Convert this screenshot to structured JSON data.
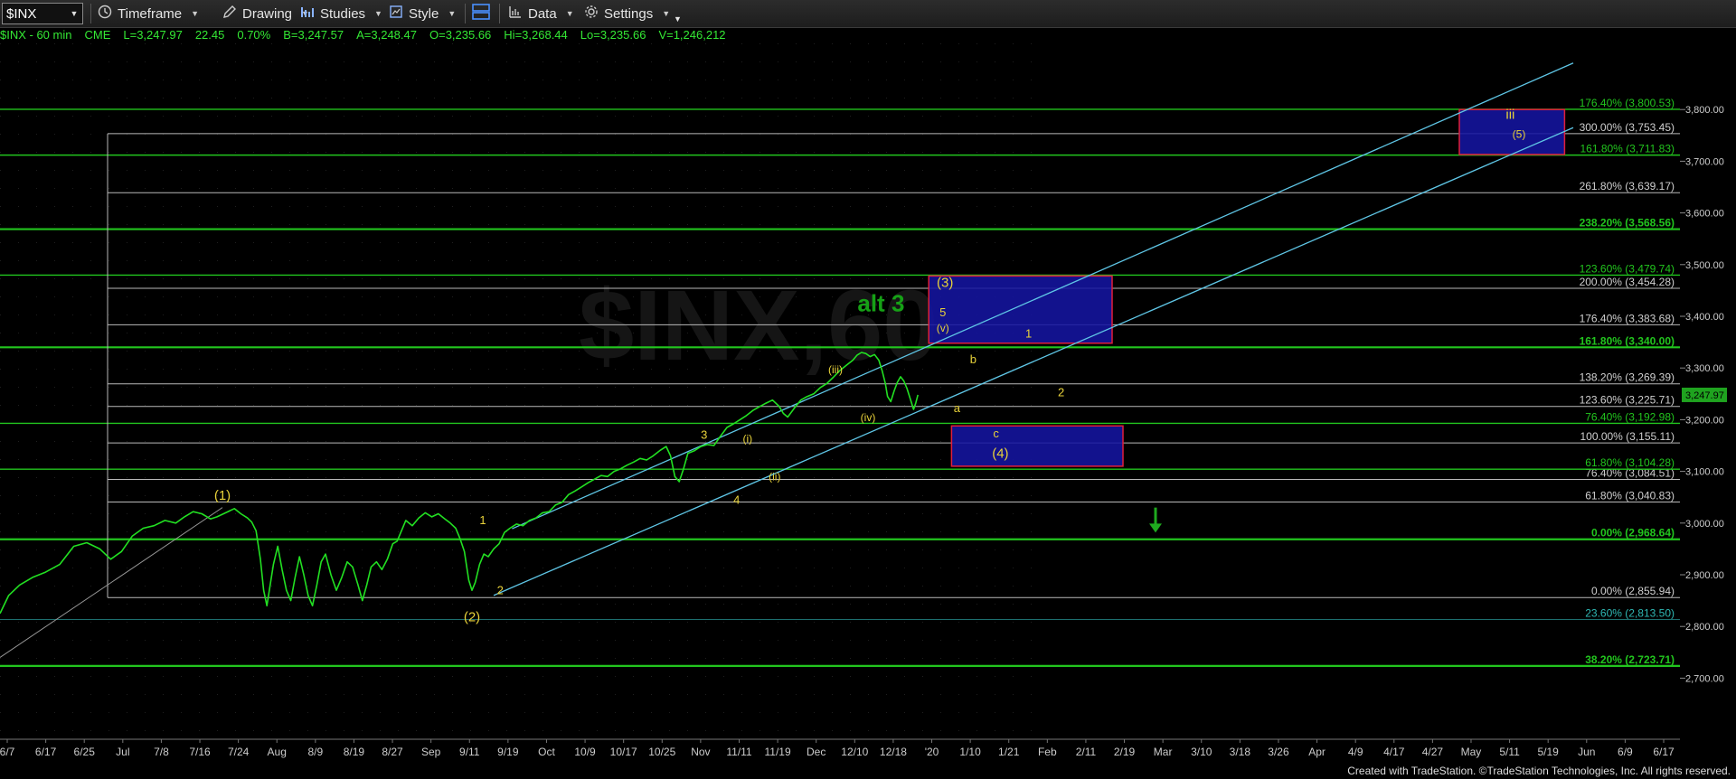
{
  "toolbar": {
    "symbol": "$INX",
    "menus": [
      {
        "label": "Timeframe",
        "icon": "clock-icon"
      },
      {
        "label": "Drawing",
        "icon": "pencil-icon"
      },
      {
        "label": "Studies",
        "icon": "studies-icon"
      },
      {
        "label": "Style",
        "icon": "style-icon"
      },
      {
        "label": "",
        "icon": "layout-icon"
      },
      {
        "label": "Data",
        "icon": "data-icon"
      },
      {
        "label": "Settings",
        "icon": "gear-icon"
      }
    ]
  },
  "infobar": {
    "symbol": "$INX - 60 min",
    "exchange": "CME",
    "last": "L=3,247.97",
    "change": "22.45",
    "pct": "0.70%",
    "bid": "B=3,247.57",
    "ask": "A=3,248.47",
    "open": "O=3,235.66",
    "high": "Hi=3,268.44",
    "low": "Lo=3,235.66",
    "volume": "V=1,246,212"
  },
  "footer": "Created with TradeStation. ©TradeStation Technologies, Inc. All rights reserved.",
  "colors": {
    "price": "#22e022",
    "green_line": "#22c51e",
    "gray_line": "#b9b9b9",
    "channel": "#5fc6e6",
    "box_fill": "#1515a0",
    "box_border": "#e01e3c",
    "wave_label": "#e8d23a",
    "alt_label": "#16a116",
    "teal_text": "#2fb8b4"
  },
  "chart_data": {
    "type": "line",
    "title": "$INX - 60 min",
    "ylim": [
      2640,
      3910
    ],
    "y_ticks": [
      "3,800.00",
      "3,700.00",
      "3,600.00",
      "3,500.00",
      "3,400.00",
      "3,300.00",
      "3,200.00",
      "3,100.00",
      "3,000.00",
      "2,900.00",
      "2,800.00",
      "2,700.00"
    ],
    "last_price_tag": "3,247.97",
    "x_tick_labels": [
      "6/7",
      "6/17",
      "6/25",
      "Jul",
      "7/8",
      "7/16",
      "7/24",
      "Aug",
      "8/9",
      "8/19",
      "8/27",
      "Sep",
      "9/11",
      "9/19",
      "Oct",
      "10/9",
      "10/17",
      "10/25",
      "Nov",
      "11/11",
      "11/19",
      "Dec",
      "12/10",
      "12/18",
      "'20",
      "1/10",
      "1/21",
      "Feb",
      "2/11",
      "2/19",
      "Mar",
      "3/10",
      "3/18",
      "3/26",
      "Apr",
      "4/9",
      "4/17",
      "4/27",
      "May",
      "5/11",
      "5/19",
      "Jun",
      "6/9",
      "6/17"
    ],
    "series": [
      {
        "values": [
          {
            "x": 0,
            "y": 2825
          },
          {
            "x": 8,
            "y": 2860
          },
          {
            "x": 18,
            "y": 2880
          },
          {
            "x": 30,
            "y": 2895
          },
          {
            "x": 42,
            "y": 2905
          },
          {
            "x": 55,
            "y": 2920
          },
          {
            "x": 68,
            "y": 2955
          },
          {
            "x": 80,
            "y": 2962
          },
          {
            "x": 92,
            "y": 2950
          },
          {
            "x": 102,
            "y": 2930
          },
          {
            "x": 112,
            "y": 2945
          },
          {
            "x": 122,
            "y": 2975
          },
          {
            "x": 132,
            "y": 2990
          },
          {
            "x": 142,
            "y": 2995
          },
          {
            "x": 152,
            "y": 3005
          },
          {
            "x": 162,
            "y": 3000
          },
          {
            "x": 170,
            "y": 3012
          },
          {
            "x": 178,
            "y": 3022
          },
          {
            "x": 186,
            "y": 3018
          },
          {
            "x": 194,
            "y": 3008
          },
          {
            "x": 200,
            "y": 3012
          },
          {
            "x": 208,
            "y": 3020
          },
          {
            "x": 216,
            "y": 3028
          },
          {
            "x": 222,
            "y": 3018
          },
          {
            "x": 228,
            "y": 3010
          },
          {
            "x": 232,
            "y": 3002
          },
          {
            "x": 236,
            "y": 2985
          },
          {
            "x": 240,
            "y": 2930
          },
          {
            "x": 243,
            "y": 2870
          },
          {
            "x": 246,
            "y": 2840
          },
          {
            "x": 249,
            "y": 2880
          },
          {
            "x": 252,
            "y": 2920
          },
          {
            "x": 256,
            "y": 2955
          },
          {
            "x": 260,
            "y": 2910
          },
          {
            "x": 264,
            "y": 2870
          },
          {
            "x": 268,
            "y": 2850
          },
          {
            "x": 272,
            "y": 2895
          },
          {
            "x": 276,
            "y": 2935
          },
          {
            "x": 280,
            "y": 2900
          },
          {
            "x": 284,
            "y": 2860
          },
          {
            "x": 288,
            "y": 2840
          },
          {
            "x": 292,
            "y": 2880
          },
          {
            "x": 296,
            "y": 2925
          },
          {
            "x": 300,
            "y": 2940
          },
          {
            "x": 305,
            "y": 2900
          },
          {
            "x": 310,
            "y": 2870
          },
          {
            "x": 315,
            "y": 2895
          },
          {
            "x": 320,
            "y": 2925
          },
          {
            "x": 325,
            "y": 2915
          },
          {
            "x": 330,
            "y": 2880
          },
          {
            "x": 334,
            "y": 2850
          },
          {
            "x": 338,
            "y": 2880
          },
          {
            "x": 342,
            "y": 2915
          },
          {
            "x": 347,
            "y": 2925
          },
          {
            "x": 352,
            "y": 2910
          },
          {
            "x": 357,
            "y": 2930
          },
          {
            "x": 362,
            "y": 2960
          },
          {
            "x": 366,
            "y": 2965
          },
          {
            "x": 370,
            "y": 2985
          },
          {
            "x": 374,
            "y": 3005
          },
          {
            "x": 380,
            "y": 2995
          },
          {
            "x": 386,
            "y": 3010
          },
          {
            "x": 392,
            "y": 3020
          },
          {
            "x": 398,
            "y": 3012
          },
          {
            "x": 404,
            "y": 3018
          },
          {
            "x": 410,
            "y": 3008
          },
          {
            "x": 415,
            "y": 3000
          },
          {
            "x": 420,
            "y": 2990
          },
          {
            "x": 424,
            "y": 2970
          },
          {
            "x": 428,
            "y": 2945
          },
          {
            "x": 432,
            "y": 2890
          },
          {
            "x": 435,
            "y": 2870
          },
          {
            "x": 438,
            "y": 2885
          },
          {
            "x": 442,
            "y": 2920
          },
          {
            "x": 446,
            "y": 2940
          },
          {
            "x": 450,
            "y": 2935
          },
          {
            "x": 455,
            "y": 2950
          },
          {
            "x": 460,
            "y": 2960
          },
          {
            "x": 465,
            "y": 2982
          },
          {
            "x": 470,
            "y": 2990
          },
          {
            "x": 476,
            "y": 2998
          },
          {
            "x": 482,
            "y": 2995
          },
          {
            "x": 488,
            "y": 3005
          },
          {
            "x": 494,
            "y": 3010
          },
          {
            "x": 500,
            "y": 3020
          },
          {
            "x": 506,
            "y": 3022
          },
          {
            "x": 512,
            "y": 3035
          },
          {
            "x": 518,
            "y": 3040
          },
          {
            "x": 524,
            "y": 3055
          },
          {
            "x": 530,
            "y": 3062
          },
          {
            "x": 536,
            "y": 3070
          },
          {
            "x": 542,
            "y": 3078
          },
          {
            "x": 548,
            "y": 3085
          },
          {
            "x": 554,
            "y": 3092
          },
          {
            "x": 560,
            "y": 3090
          },
          {
            "x": 566,
            "y": 3100
          },
          {
            "x": 572,
            "y": 3105
          },
          {
            "x": 578,
            "y": 3112
          },
          {
            "x": 584,
            "y": 3118
          },
          {
            "x": 590,
            "y": 3125
          },
          {
            "x": 596,
            "y": 3122
          },
          {
            "x": 602,
            "y": 3130
          },
          {
            "x": 608,
            "y": 3140
          },
          {
            "x": 614,
            "y": 3148
          },
          {
            "x": 618,
            "y": 3130
          },
          {
            "x": 622,
            "y": 3090
          },
          {
            "x": 626,
            "y": 3080
          },
          {
            "x": 630,
            "y": 3105
          },
          {
            "x": 634,
            "y": 3135
          },
          {
            "x": 640,
            "y": 3140
          },
          {
            "x": 646,
            "y": 3148
          },
          {
            "x": 652,
            "y": 3152
          },
          {
            "x": 658,
            "y": 3150
          },
          {
            "x": 664,
            "y": 3168
          },
          {
            "x": 670,
            "y": 3185
          },
          {
            "x": 676,
            "y": 3192
          },
          {
            "x": 682,
            "y": 3200
          },
          {
            "x": 688,
            "y": 3208
          },
          {
            "x": 694,
            "y": 3218
          },
          {
            "x": 700,
            "y": 3225
          },
          {
            "x": 706,
            "y": 3232
          },
          {
            "x": 712,
            "y": 3238
          },
          {
            "x": 718,
            "y": 3226
          },
          {
            "x": 722,
            "y": 3212
          },
          {
            "x": 726,
            "y": 3205
          },
          {
            "x": 732,
            "y": 3222
          },
          {
            "x": 738,
            "y": 3238
          },
          {
            "x": 744,
            "y": 3245
          },
          {
            "x": 750,
            "y": 3250
          },
          {
            "x": 756,
            "y": 3262
          },
          {
            "x": 762,
            "y": 3270
          },
          {
            "x": 768,
            "y": 3282
          },
          {
            "x": 774,
            "y": 3295
          },
          {
            "x": 780,
            "y": 3305
          },
          {
            "x": 786,
            "y": 3315
          },
          {
            "x": 790,
            "y": 3325
          },
          {
            "x": 794,
            "y": 3330
          },
          {
            "x": 798,
            "y": 3328
          },
          {
            "x": 802,
            "y": 3322
          },
          {
            "x": 806,
            "y": 3326
          },
          {
            "x": 810,
            "y": 3315
          },
          {
            "x": 813,
            "y": 3295
          },
          {
            "x": 816,
            "y": 3270
          },
          {
            "x": 818,
            "y": 3245
          },
          {
            "x": 821,
            "y": 3235
          },
          {
            "x": 824,
            "y": 3255
          },
          {
            "x": 827,
            "y": 3272
          },
          {
            "x": 830,
            "y": 3283
          },
          {
            "x": 833,
            "y": 3275
          },
          {
            "x": 836,
            "y": 3260
          },
          {
            "x": 839,
            "y": 3240
          },
          {
            "x": 842,
            "y": 3220
          },
          {
            "x": 844,
            "y": 3232
          },
          {
            "x": 846,
            "y": 3248
          }
        ]
      }
    ],
    "green_levels": [
      {
        "price": 3800.53,
        "label": "176.40% (3,800.53)",
        "bold": false
      },
      {
        "price": 3711.83,
        "label": "161.80% (3,711.83)",
        "bold": false
      },
      {
        "price": 3568.56,
        "label": "238.20% (3,568.56)",
        "bold": true
      },
      {
        "price": 3479.74,
        "label": "123.60% (3,479.74)",
        "bold": false
      },
      {
        "price": 3340.0,
        "label": "161.80% (3,340.00)",
        "bold": true
      },
      {
        "price": 3192.98,
        "label": "76.40% (3,192.98)",
        "bold": false
      },
      {
        "price": 3104.28,
        "label": "61.80% (3,104.28)",
        "bold": false
      },
      {
        "price": 2968.64,
        "label": "0.00% (2,968.64)",
        "bold": true
      },
      {
        "price": 2723.71,
        "label": "38.20% (2,723.71)",
        "bold": true
      }
    ],
    "gray_levels": [
      {
        "price": 3753.45,
        "label": "300.00% (3,753.45)"
      },
      {
        "price": 3639.17,
        "label": "261.80% (3,639.17)"
      },
      {
        "price": 3454.28,
        "label": "200.00% (3,454.28)"
      },
      {
        "price": 3383.68,
        "label": "176.40% (3,383.68)"
      },
      {
        "price": 3269.39,
        "label": "138.20% (3,269.39)"
      },
      {
        "price": 3225.71,
        "label": "123.60% (3,225.71)"
      },
      {
        "price": 3155.11,
        "label": "100.00% (3,155.11)"
      },
      {
        "price": 3084.51,
        "label": "76.40% (3,084.51)"
      },
      {
        "price": 3040.83,
        "label": "61.80% (3,040.83)"
      },
      {
        "price": 2855.94,
        "label": "0.00% (2,855.94)"
      }
    ],
    "teal_levels": [
      {
        "price": 2813.5,
        "label": "23.60% (2,813.50)"
      }
    ],
    "wave_labels": [
      {
        "text": "(1)",
        "x": 205,
        "y": 3045,
        "size": 15
      },
      {
        "text": "(2)",
        "x": 435,
        "y": 2810,
        "size": 15
      },
      {
        "text": "1",
        "x": 445,
        "y": 2998,
        "size": 13
      },
      {
        "text": "2",
        "x": 461,
        "y": 2862,
        "size": 13
      },
      {
        "text": "3",
        "x": 649,
        "y": 3163,
        "size": 13
      },
      {
        "text": "4",
        "x": 679,
        "y": 3037,
        "size": 13
      },
      {
        "text": "(i)",
        "x": 689,
        "y": 3156,
        "size": 12
      },
      {
        "text": "(ii)",
        "x": 714,
        "y": 3083,
        "size": 12
      },
      {
        "text": "(iii)",
        "x": 770,
        "y": 3290,
        "size": 12
      },
      {
        "text": "(iv)",
        "x": 800,
        "y": 3197,
        "size": 12
      },
      {
        "text": "(3)",
        "x": 871,
        "y": 3457,
        "size": 15
      },
      {
        "text": "5",
        "x": 869,
        "y": 3400,
        "size": 13
      },
      {
        "text": "(v)",
        "x": 869,
        "y": 3370,
        "size": 12
      },
      {
        "text": "b",
        "x": 897,
        "y": 3309,
        "size": 13
      },
      {
        "text": "a",
        "x": 882,
        "y": 3215,
        "size": 13
      },
      {
        "text": "c",
        "x": 918,
        "y": 3166,
        "size": 13
      },
      {
        "text": "(4)",
        "x": 922,
        "y": 3126,
        "size": 15
      },
      {
        "text": "1",
        "x": 948,
        "y": 3359,
        "size": 13
      },
      {
        "text": "2",
        "x": 978,
        "y": 3245,
        "size": 13
      },
      {
        "text": "iii",
        "x": 1392,
        "y": 3782,
        "size": 15
      },
      {
        "text": "(5)",
        "x": 1400,
        "y": 3745,
        "size": 12
      }
    ],
    "alt_label": {
      "text": "alt 3",
      "x": 812,
      "y": 3410
    },
    "watermark": "$INX,60",
    "boxes": [
      {
        "x0": 856,
        "x1": 1025,
        "y0": 3348,
        "y1": 3478
      },
      {
        "x0": 877,
        "x1": 1035,
        "y0": 3110,
        "y1": 3188
      },
      {
        "x0": 1345,
        "x1": 1442,
        "y0": 3713,
        "y1": 3800
      }
    ],
    "channel_lines": [
      {
        "x0": 472,
        "y0": 2989,
        "x1": 1450,
        "y1": 3890
      },
      {
        "x0": 455,
        "y0": 2860,
        "x1": 1450,
        "y1": 3765
      }
    ],
    "diag_line": {
      "x0": 0,
      "y0": 2740,
      "x1": 205,
      "y1": 3030
    },
    "arrow": {
      "x": 1065,
      "y_top": 3030,
      "y_bot": 2985
    }
  }
}
